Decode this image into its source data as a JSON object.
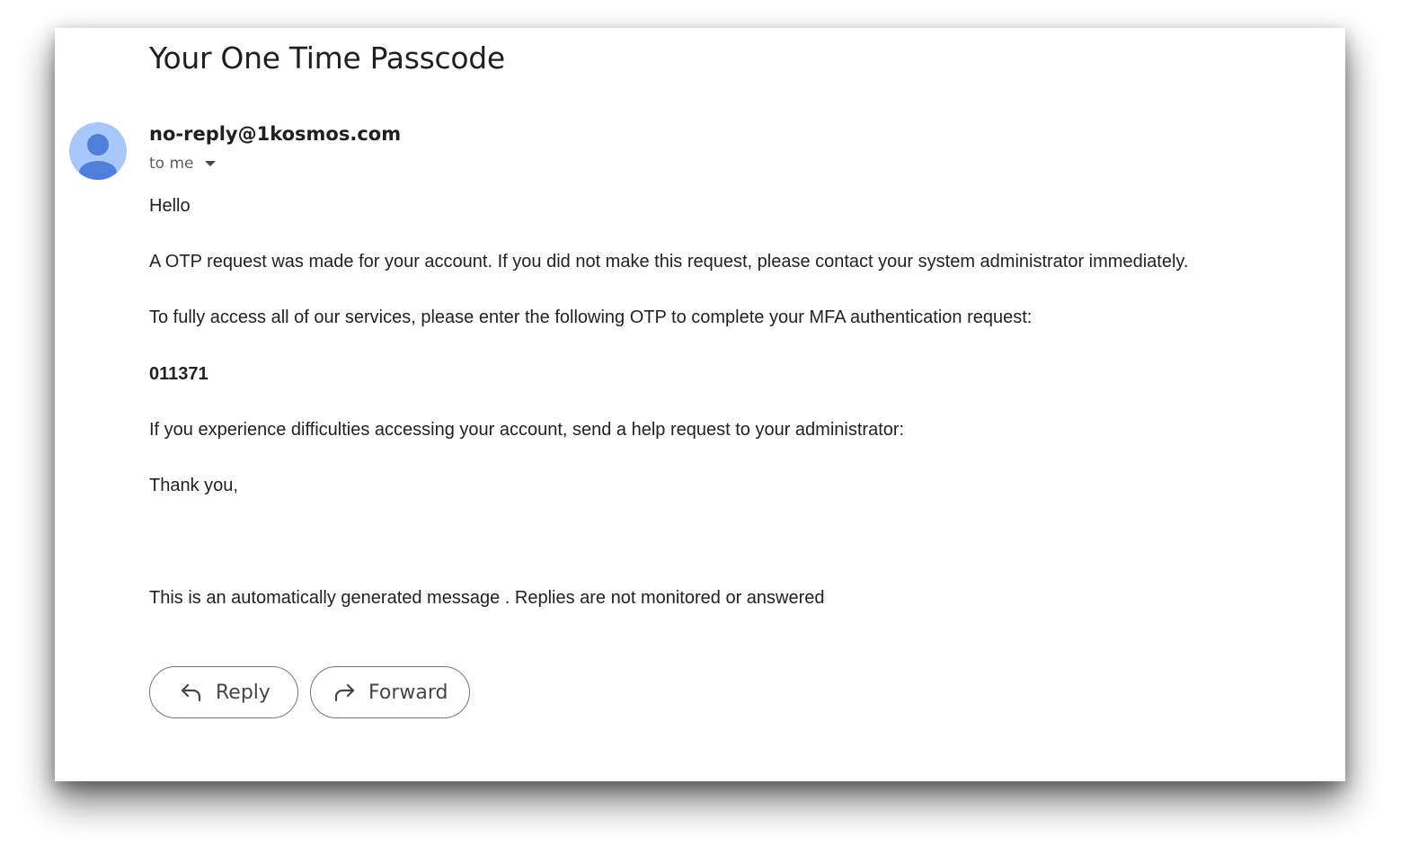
{
  "email": {
    "subject": "Your One Time Passcode",
    "sender": "no-reply@1kosmos.com",
    "recipient_label": "to me",
    "avatar_icon": "person-icon",
    "avatar_color": "#a8c7fa",
    "avatar_figure_color": "#4f7edb",
    "body": {
      "greeting": "Hello",
      "line1": "A OTP request was made for your account. If you did not make this request, please contact your system administrator immediately.",
      "line2": "To fully access all of our services, please enter the following OTP to complete your MFA authentication request:",
      "otp_code": "011371",
      "line3": "If you experience difficulties accessing your account, send a help request to your administrator:",
      "signoff": "Thank you,",
      "footer": "This is an automatically generated message . Replies are not monitored or answered"
    }
  },
  "actions": {
    "reply_label": "Reply",
    "reply_icon": "reply-arrow-icon",
    "forward_label": "Forward",
    "forward_icon": "forward-arrow-icon"
  }
}
